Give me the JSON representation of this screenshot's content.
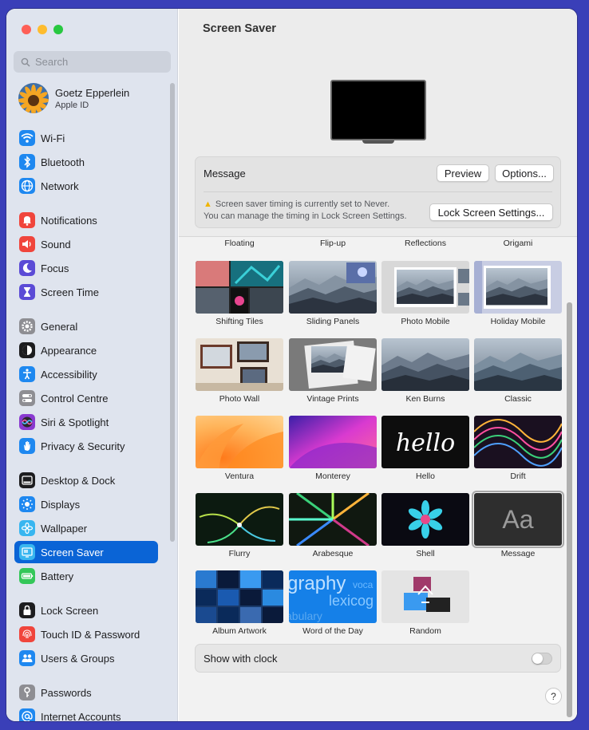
{
  "sidebar": {
    "search_placeholder": "Search",
    "account": {
      "name": "Goetz Epperlein",
      "subtitle": "Apple ID"
    },
    "items": [
      {
        "label": "Wi-Fi",
        "icon": "wifi-icon",
        "color": "#1e88f0"
      },
      {
        "label": "Bluetooth",
        "icon": "bluetooth-icon",
        "color": "#1e88f0"
      },
      {
        "label": "Network",
        "icon": "globe-icon",
        "color": "#1e88f0"
      },
      {
        "label": "Notifications",
        "icon": "bell-icon",
        "color": "#f0453c"
      },
      {
        "label": "Sound",
        "icon": "speaker-icon",
        "color": "#f0453c"
      },
      {
        "label": "Focus",
        "icon": "moon-icon",
        "color": "#5b4bd6"
      },
      {
        "label": "Screen Time",
        "icon": "hourglass-icon",
        "color": "#5b4bd6"
      },
      {
        "label": "General",
        "icon": "gear-icon",
        "color": "#8e8e93"
      },
      {
        "label": "Appearance",
        "icon": "appearance-icon",
        "color": "#1d1d1f"
      },
      {
        "label": "Accessibility",
        "icon": "accessibility-icon",
        "color": "#1e88f0"
      },
      {
        "label": "Control Centre",
        "icon": "control-centre-icon",
        "color": "#8e8e93"
      },
      {
        "label": "Siri & Spotlight",
        "icon": "siri-icon",
        "color": "#8a3ad0"
      },
      {
        "label": "Privacy & Security",
        "icon": "hand-icon",
        "color": "#1e88f0"
      },
      {
        "label": "Desktop & Dock",
        "icon": "dock-icon",
        "color": "#1d1d1f"
      },
      {
        "label": "Displays",
        "icon": "sun-icon",
        "color": "#1e88f0"
      },
      {
        "label": "Wallpaper",
        "icon": "flower-icon",
        "color": "#38b6f0"
      },
      {
        "label": "Screen Saver",
        "icon": "screen-saver-icon",
        "color": "#38b6f0",
        "selected": true
      },
      {
        "label": "Battery",
        "icon": "battery-icon",
        "color": "#34c759"
      },
      {
        "label": "Lock Screen",
        "icon": "lock-icon",
        "color": "#1d1d1f"
      },
      {
        "label": "Touch ID & Password",
        "icon": "fingerprint-icon",
        "color": "#f0453c"
      },
      {
        "label": "Users & Groups",
        "icon": "users-icon",
        "color": "#1e88f0"
      },
      {
        "label": "Passwords",
        "icon": "key-icon",
        "color": "#8e8e93"
      },
      {
        "label": "Internet Accounts",
        "icon": "at-icon",
        "color": "#1e88f0"
      }
    ]
  },
  "main": {
    "title": "Screen Saver",
    "message_panel": {
      "label": "Message",
      "preview_label": "Preview",
      "options_label": "Options...",
      "warning_line1": "Screen saver timing is currently set to Never.",
      "warning_line2": "You can manage the timing in Lock Screen Settings.",
      "lock_button_label": "Lock Screen Settings..."
    },
    "top_labels": [
      "Floating",
      "Flip-up",
      "Reflections",
      "Origami"
    ],
    "savers": [
      {
        "label": "Shifting Tiles"
      },
      {
        "label": "Sliding Panels"
      },
      {
        "label": "Photo Mobile"
      },
      {
        "label": "Holiday Mobile"
      },
      {
        "label": "Photo Wall"
      },
      {
        "label": "Vintage Prints"
      },
      {
        "label": "Ken Burns"
      },
      {
        "label": "Classic"
      },
      {
        "label": "Ventura"
      },
      {
        "label": "Monterey"
      },
      {
        "label": "Hello",
        "thumb_text": "hello"
      },
      {
        "label": "Drift"
      },
      {
        "label": "Flurry"
      },
      {
        "label": "Arabesque"
      },
      {
        "label": "Shell"
      },
      {
        "label": "Message",
        "thumb_text": "Aa",
        "selected": true
      },
      {
        "label": "Album Artwork"
      },
      {
        "label": "Word of the Day",
        "thumb_words": [
          "graphy",
          "voca",
          "lexicog",
          "abulary"
        ]
      },
      {
        "label": "Random"
      }
    ],
    "show_with_clock": {
      "label": "Show with clock",
      "enabled": false
    },
    "help_label": "?"
  }
}
